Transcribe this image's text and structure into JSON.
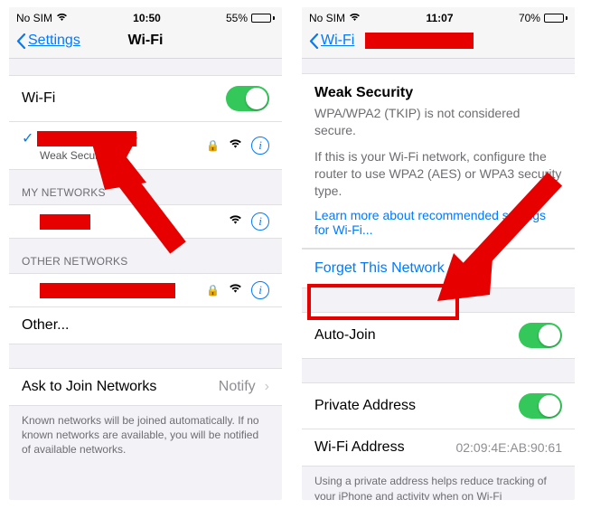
{
  "left": {
    "status": {
      "carrier": "No SIM",
      "time": "10:50",
      "battery_pct": "55%"
    },
    "nav": {
      "back": "Settings",
      "title": "Wi-Fi"
    },
    "wifi_toggle": {
      "label": "Wi-Fi",
      "on": true
    },
    "current": {
      "sub": "Weak Security"
    },
    "sections": {
      "my": "MY NETWORKS",
      "other": "OTHER NETWORKS"
    },
    "other_label": "Other...",
    "ask": {
      "label": "Ask to Join Networks",
      "value": "Notify"
    },
    "footer": "Known networks will be joined automatically. If no known networks are available, you will be notified of available networks."
  },
  "right": {
    "status": {
      "carrier": "No SIM",
      "time": "11:07",
      "battery_pct": "70%"
    },
    "nav": {
      "back": "Wi-Fi"
    },
    "sec": {
      "title": "Weak Security",
      "msg1": "WPA/WPA2 (TKIP) is not considered secure.",
      "msg2": "If this is your Wi-Fi network, configure the router to use WPA2 (AES) or WPA3 security type.",
      "link": "Learn more about recommended settings for Wi-Fi..."
    },
    "forget": "Forget This Network",
    "auto_join": {
      "label": "Auto-Join",
      "on": true
    },
    "private_addr": {
      "label": "Private Address",
      "on": true
    },
    "wifi_addr": {
      "label": "Wi-Fi Address",
      "value": "02:09:4E:AB:90:61"
    },
    "footer": "Using a private address helps reduce tracking of your iPhone and activity when on Wi-Fi"
  }
}
